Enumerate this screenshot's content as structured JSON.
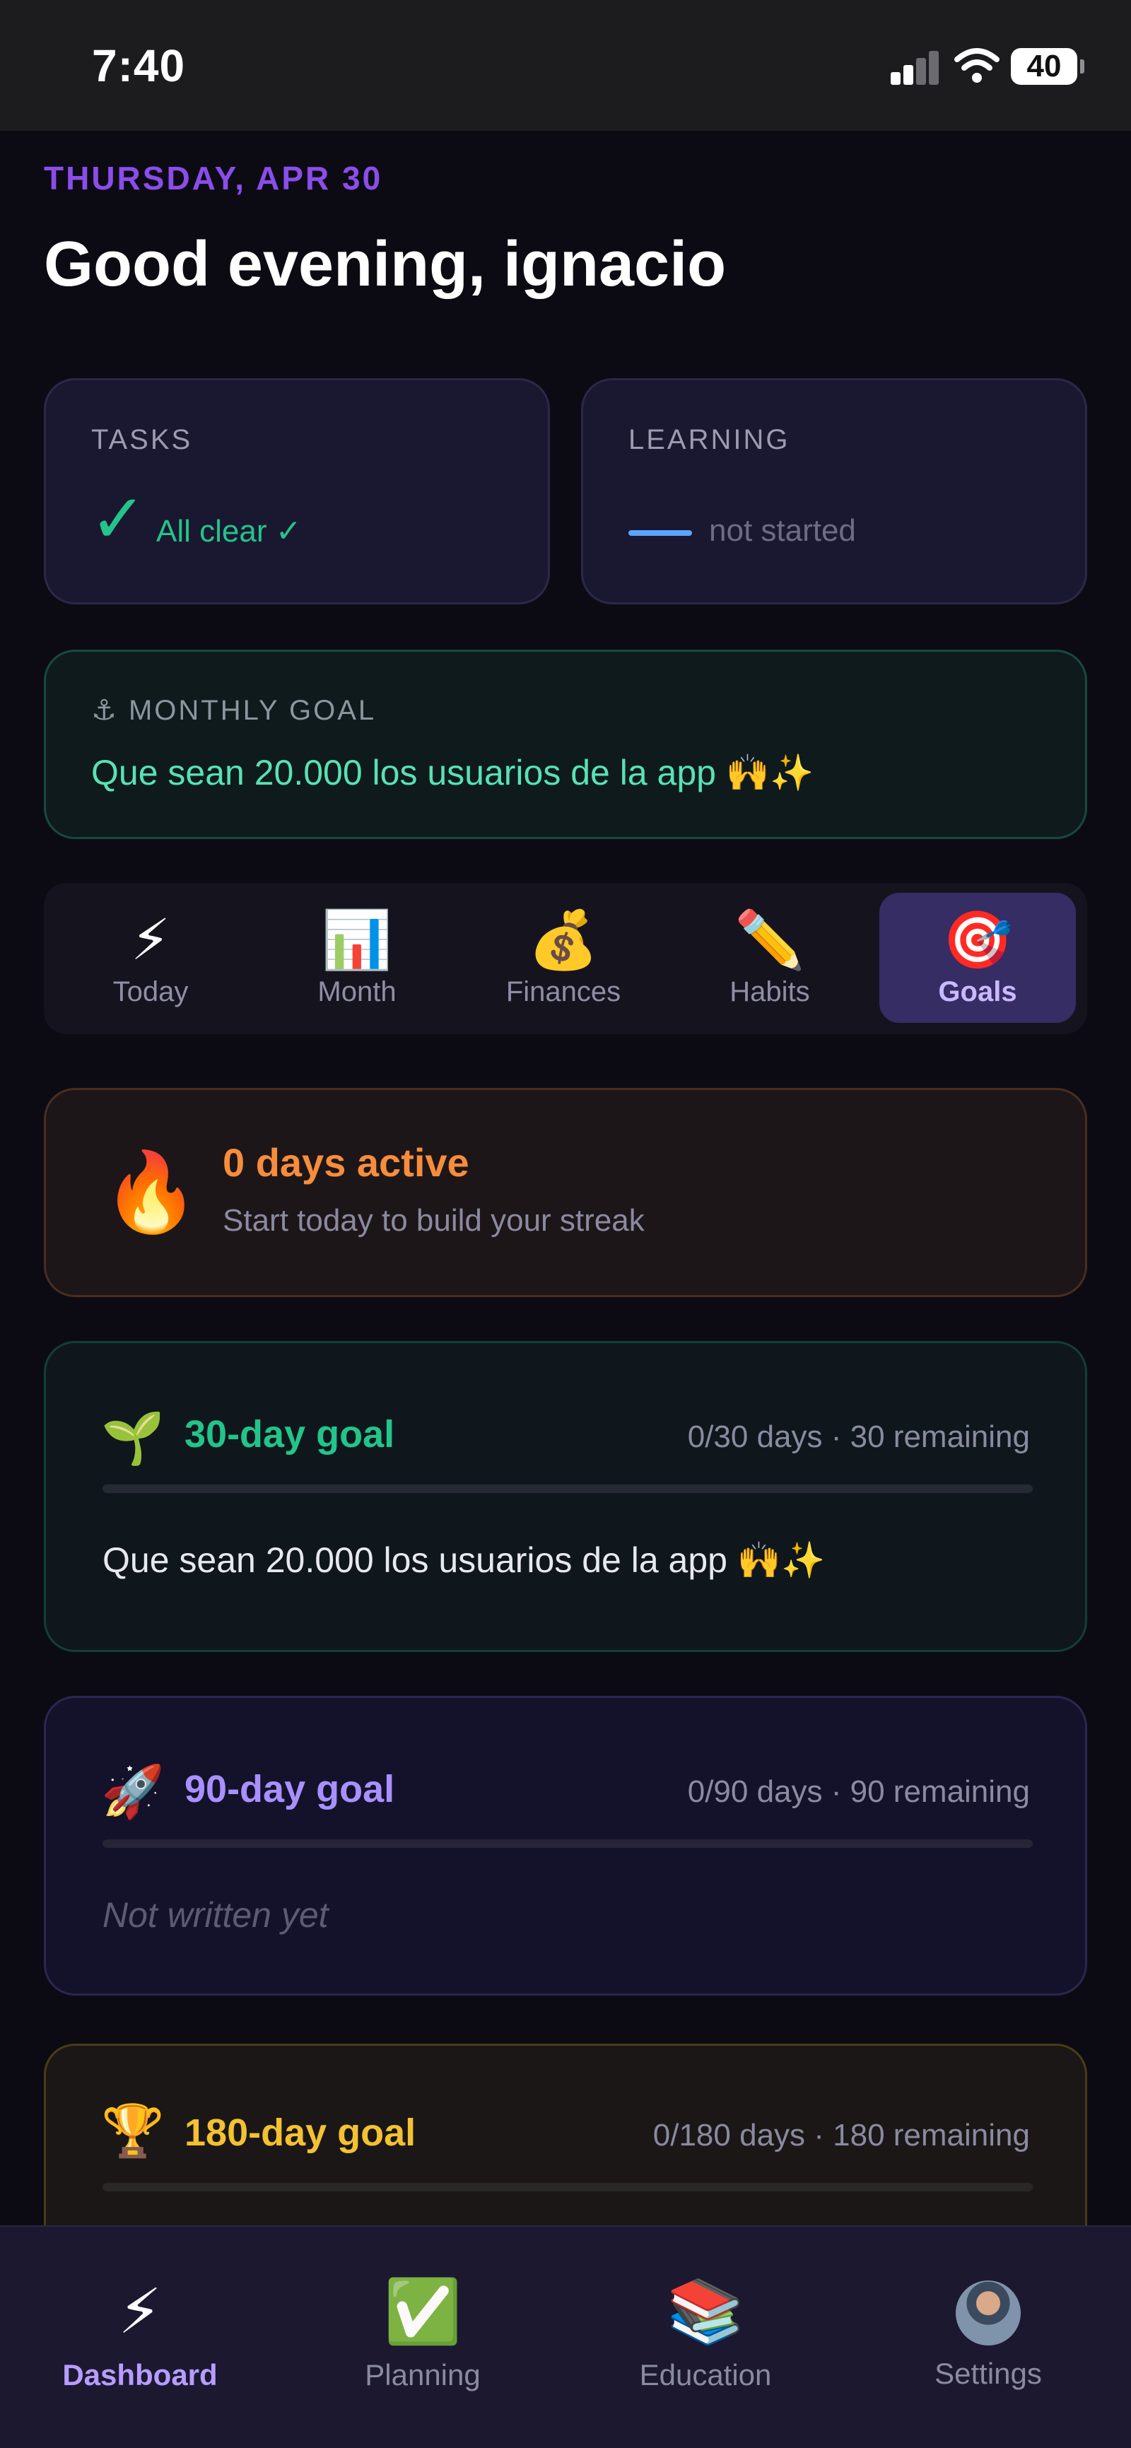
{
  "status_bar": {
    "time": "7:40",
    "battery": "40"
  },
  "header": {
    "date": "THURSDAY, APR 30",
    "greeting": "Good evening, ignacio"
  },
  "stats": {
    "tasks": {
      "title": "TASKS",
      "check": "✓",
      "value": "All clear ✓"
    },
    "learning": {
      "title": "LEARNING",
      "value": "not started"
    }
  },
  "monthly_goal": {
    "label": "⚓ MONTHLY GOAL",
    "text": "Que sean 20.000 los usuarios de la app 🙌✨"
  },
  "tabs": [
    {
      "icon": "⚡",
      "label": "Today"
    },
    {
      "icon": "📊",
      "label": "Month"
    },
    {
      "icon": "💰",
      "label": "Finances"
    },
    {
      "icon": "✏️",
      "label": "Habits"
    },
    {
      "icon": "🎯",
      "label": "Goals"
    }
  ],
  "streak": {
    "icon": "🔥",
    "title": "0 days active",
    "subtitle": "Start today to build your streak"
  },
  "goals": {
    "g30": {
      "icon": "🌱",
      "title": "30-day goal",
      "meta": "0/30 days · 30 remaining",
      "progress": 0,
      "text": "Que sean 20.000 los usuarios de la app 🙌✨"
    },
    "g90": {
      "icon": "🚀",
      "title": "90-day goal",
      "meta": "0/90 days · 90 remaining",
      "progress": 0,
      "text": "Not written yet"
    },
    "g180": {
      "icon": "🏆",
      "title": "180-day goal",
      "meta": "0/180 days · 180 remaining",
      "progress": 0
    }
  },
  "bottom_nav": [
    {
      "icon": "⚡",
      "label": "Dashboard"
    },
    {
      "icon": "✅",
      "label": "Planning"
    },
    {
      "icon": "📚",
      "label": "Education"
    },
    {
      "label": "Settings"
    }
  ],
  "colors": {
    "accent_purple": "#8b4dea",
    "green": "#23c48a",
    "orange": "#f68d3c",
    "violet": "#a890ff",
    "gold": "#f3c132"
  }
}
